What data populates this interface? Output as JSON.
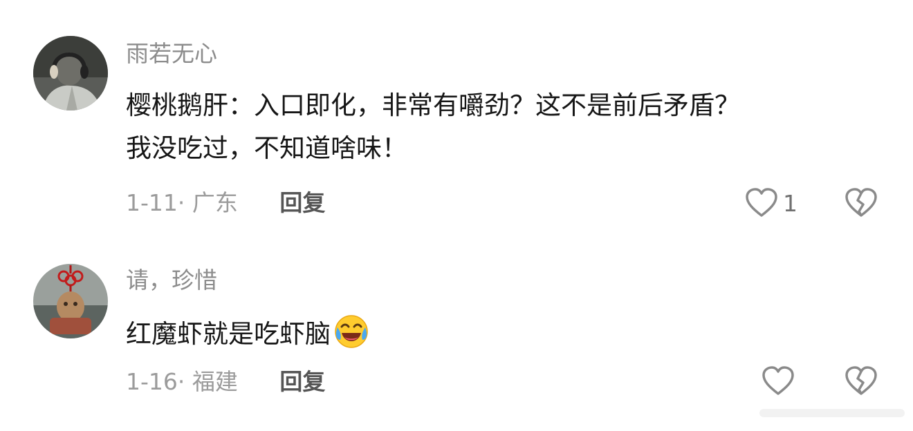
{
  "comments": [
    {
      "username": "雨若无心",
      "lines": [
        "樱桃鹅肝：入口即化，非常有嚼劲？这不是前后矛盾？",
        "我没吃过，不知道啥味！"
      ],
      "date": "1-11",
      "location": "广东",
      "reply_label": "回复",
      "like_count": "1",
      "avatar_icon": "user-photo-headphones",
      "like_icon": "heart-outline-icon",
      "dislike_icon": "broken-heart-icon"
    },
    {
      "username": "请，珍惜",
      "text": "红魔虾就是吃虾脑",
      "emoji": "laughing-crying-emoji",
      "date": "1-16",
      "location": "福建",
      "reply_label": "回复",
      "avatar_icon": "user-photo-chinese-knot",
      "like_icon": "heart-outline-icon",
      "dislike_icon": "broken-heart-icon"
    }
  ],
  "colors": {
    "username": "#8c8c8c",
    "content": "#161616",
    "meta": "#9b9b9b",
    "reply": "#555555",
    "icon_stroke": "#8a8a8a"
  }
}
